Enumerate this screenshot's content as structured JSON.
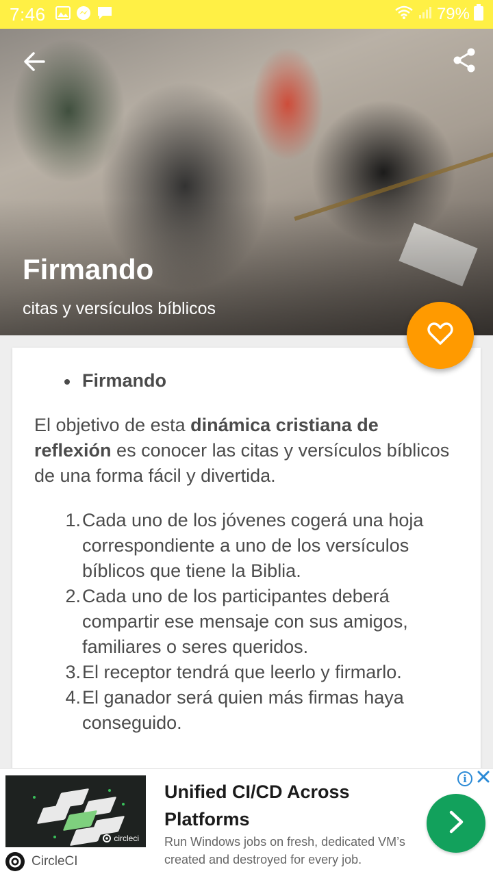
{
  "status_bar": {
    "time": "7:46",
    "battery": "79%",
    "icons": [
      "image-icon",
      "messenger-icon",
      "chat-icon",
      "wifi-icon",
      "signal-icon",
      "battery-icon"
    ]
  },
  "hero": {
    "title": "Firmando",
    "subtitle": "citas y versículos bíblicos",
    "back_icon": "arrow-back-icon",
    "share_icon": "share-icon"
  },
  "favorite": {
    "icon": "heart-outline-icon",
    "color": "#ff9a00"
  },
  "content": {
    "bullet": "Firmando",
    "intro_part1": "El objetivo de esta ",
    "intro_bold": "dinámica cristiana de reflexión",
    "intro_part2": " es conocer las citas y versículos bíblicos de una forma fácil y divertida.",
    "steps": [
      {
        "num": "1.",
        "text": "Cada uno de los jóvenes cogerá una hoja correspondiente a uno de los versículos bíblicos que tiene la Biblia."
      },
      {
        "num": "2.",
        "text": "Cada uno de los participantes deberá compartir ese mensaje con sus amigos, familiares o seres queridos."
      },
      {
        "num": "3.",
        "text": "El receptor tendrá que leerlo y firmarlo."
      },
      {
        "num": "4.",
        "text": "El ganador será quien más firmas haya conseguido."
      }
    ]
  },
  "ad": {
    "headline": "Unified CI/CD Across Platforms",
    "body": "Run Windows jobs on fresh, dedicated VM’s created and destroyed for every job.",
    "advertiser": "CircleCI",
    "image_brand": "circleci",
    "cta_color": "#12a15c",
    "info_label": "i"
  },
  "colors": {
    "status_bar": "#fff045",
    "text": "#4b4b4b",
    "accent": "#ff9a00"
  }
}
